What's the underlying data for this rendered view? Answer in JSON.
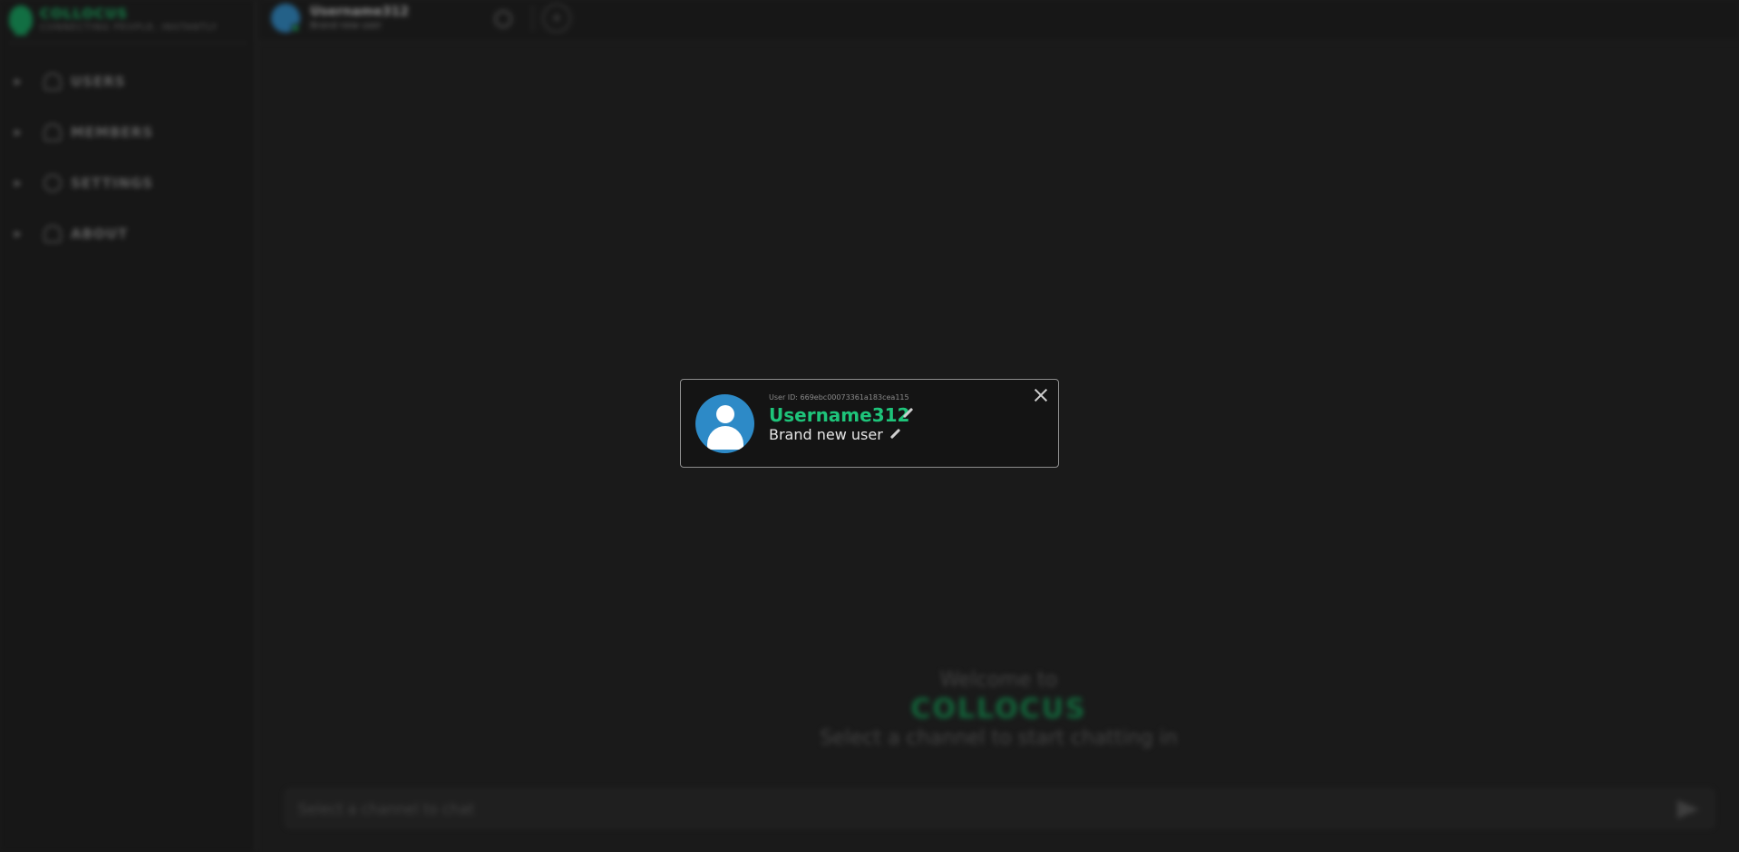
{
  "brand": {
    "name": "COLLOCUS",
    "tagline": "CONNECTING PEOPLE, INSTANTLY",
    "accent_color": "#15b865"
  },
  "sidebar": {
    "items": [
      {
        "label": "USERS",
        "icon": "user-icon"
      },
      {
        "label": "MEMBERS",
        "icon": "members-icon"
      },
      {
        "label": "SETTINGS",
        "icon": "gear-icon"
      },
      {
        "label": "ABOUT",
        "icon": "info-icon"
      }
    ]
  },
  "header": {
    "username": "Username312",
    "status": "Brand new user",
    "add_icon": "+"
  },
  "welcome": {
    "line1": "Welcome to",
    "brand": "COLLOCUS",
    "line2": "Select a channel to start chatting in"
  },
  "chat": {
    "placeholder": "Select a channel to chat"
  },
  "profile_modal": {
    "user_id": "User ID: 669ebc00073361a183cea115",
    "username": "Username312",
    "status": "Brand new user"
  }
}
